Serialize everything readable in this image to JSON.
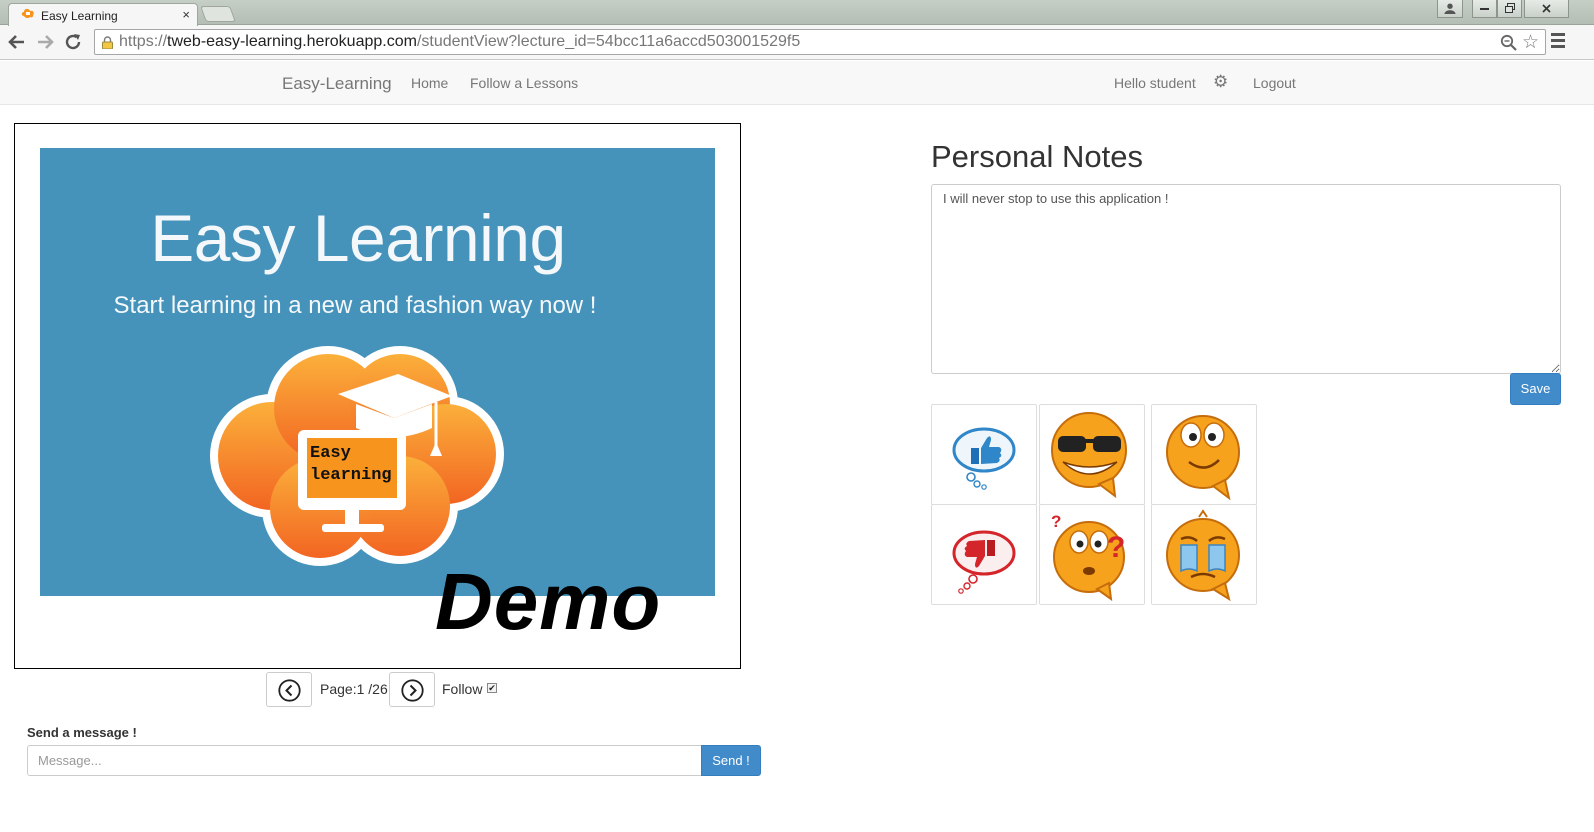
{
  "browser": {
    "tab_title": "Easy Learning",
    "tab_close": "×",
    "url_scheme": "https://",
    "url_host": "tweb-easy-learning.herokuapp.com",
    "url_path": "/studentView?lecture_id=54bcc11a6accd503001529f5",
    "icons": [
      "back-icon",
      "forward-icon",
      "reload-icon",
      "lock-icon",
      "zoom-icon",
      "star-icon",
      "menu-icon"
    ]
  },
  "navbar": {
    "brand": "Easy-Learning",
    "links": [
      "Home",
      "Follow a Lessons"
    ],
    "greeting": "Hello student",
    "logout": "Logout"
  },
  "slide": {
    "title": "Easy Learning",
    "subtitle": "Start learning in a new and fashion way now !",
    "logo_line1": "Easy",
    "logo_line2": "learning",
    "watermark": "Demo",
    "background": "#4592bb",
    "logo_color": "#f7941d"
  },
  "pager": {
    "page_prefix": "Page:",
    "current_page": 1,
    "total_pages": 26,
    "page_text": "Page:1 /26",
    "follow_label": "Follow",
    "follow_checked": true
  },
  "message": {
    "label": "Send a message !",
    "placeholder": "Message...",
    "value": "",
    "send_label": "Send !"
  },
  "notes": {
    "title": "Personal Notes",
    "content": "I will never stop to use this application !",
    "save_label": "Save"
  },
  "reactions": [
    "thumbs-up-icon",
    "cool-smiley-icon",
    "happy-smiley-icon",
    "thumbs-down-icon",
    "confused-smiley-icon",
    "crying-smiley-icon"
  ],
  "colors": {
    "primary_button": "#428bca",
    "navbar_bg": "#f8f8f8"
  }
}
